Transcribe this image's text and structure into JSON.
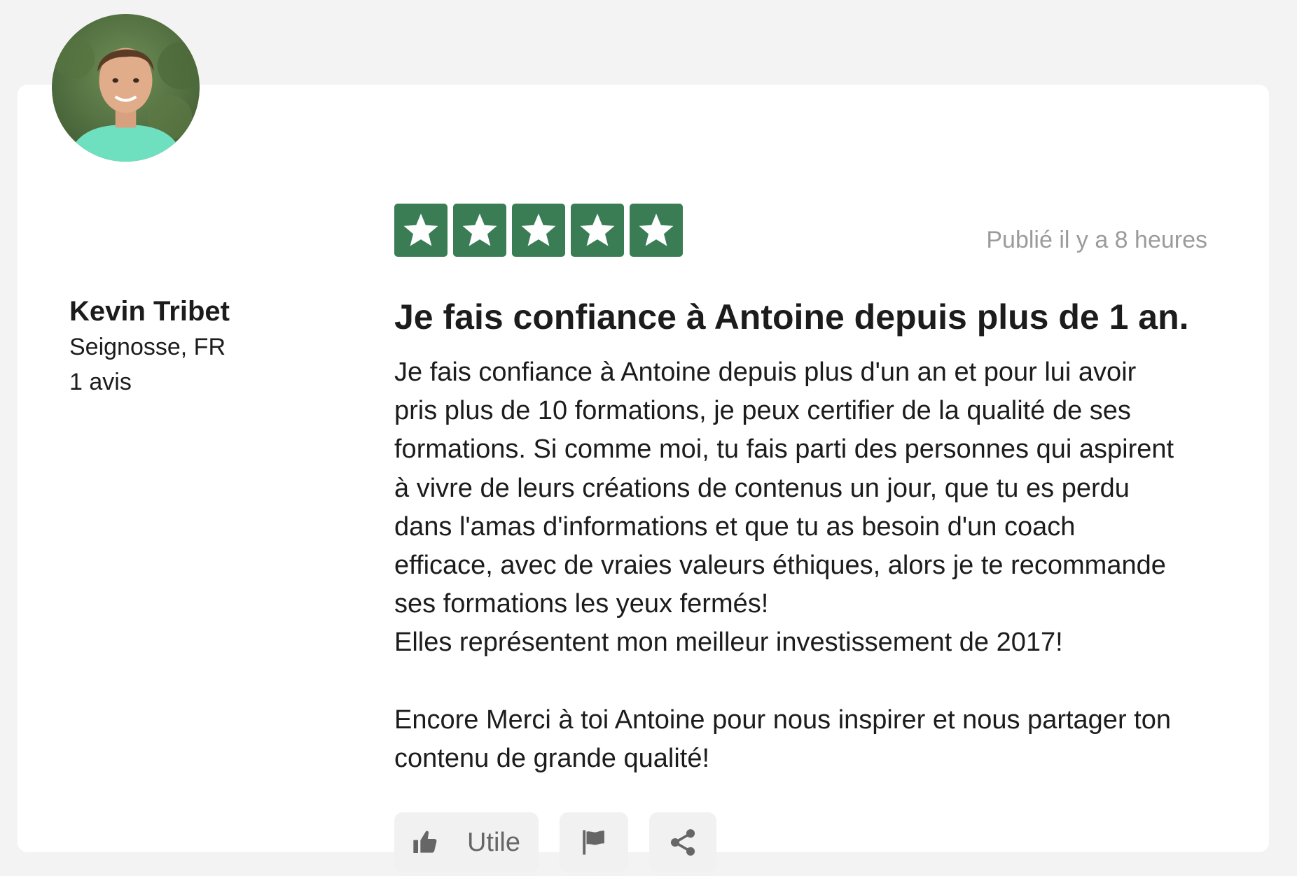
{
  "review": {
    "author": {
      "name": "Kevin Tribet",
      "location": "Seignosse, FR",
      "review_count": "1 avis"
    },
    "rating": 5,
    "stars_max": 5,
    "published": "Publié il y a 8 heures",
    "title": "Je fais confiance à Antoine depuis plus de 1 an.",
    "body_lines": [
      "Je fais confiance à Antoine depuis plus d'un an et pour lui avoir",
      "pris plus de 10 formations, je peux certifier de la qualité de ses",
      "formations. Si comme moi, tu fais parti des personnes qui aspirent",
      "à vivre de leurs créations de contenus un jour, que tu es perdu",
      "dans l'amas d'informations et que tu as besoin d'un coach",
      "efficace, avec de vraies valeurs éthiques, alors je te recommande",
      "ses formations les yeux fermés!",
      "Elles représentent mon meilleur investissement de 2017!",
      "",
      "Encore Merci à toi Antoine pour nous inspirer et nous partager ton",
      "contenu de grande qualité!"
    ],
    "actions": {
      "useful_label": "Utile",
      "useful_icon": "thumbs-up-icon",
      "flag_icon": "flag-icon",
      "share_icon": "share-icon"
    }
  },
  "colors": {
    "page_background": "#f3f3f3",
    "card_background": "#ffffff",
    "star_green": "#3a7d54",
    "muted_text": "#9b9b9b",
    "button_background": "#f1f1f1"
  }
}
